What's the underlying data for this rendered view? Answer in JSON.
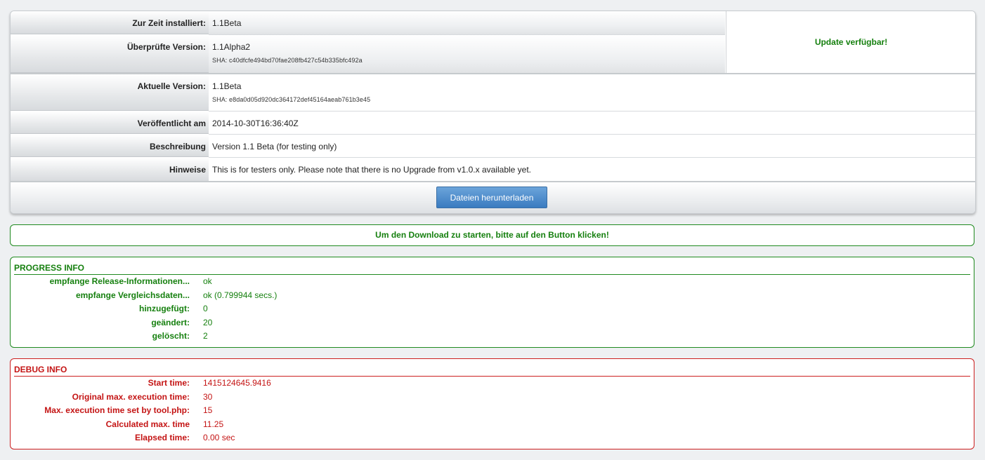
{
  "version_panel": {
    "installed_label": "Zur Zeit installiert:",
    "installed_value": "1.1Beta",
    "checked_label": "Überprüfte Version:",
    "checked_value": "1.1Alpha2",
    "checked_sha": "SHA: c40dfcfe494bd70fae208fb427c54b335bfc492a",
    "update_status": "Update verfügbar!",
    "current_label": "Aktuelle Version:",
    "current_value": "1.1Beta",
    "current_sha": "SHA: e8da0d05d920dc364172def45164aeab761b3e45",
    "published_label": "Veröffentlicht am",
    "published_value": "2014-10-30T16:36:40Z",
    "description_label": "Beschreibung",
    "description_value": "Version 1.1 Beta (for testing only)",
    "notes_label": "Hinweise",
    "notes_value": "This is for testers only. Please note that there is no Upgrade from v1.0.x available yet.",
    "download_button": "Dateien herunterladen"
  },
  "notice": "Um den Download zu starten, bitte auf den Button klicken!",
  "progress_info": {
    "title": "PROGRESS INFO",
    "rows": [
      {
        "key": "empfange Release-Informationen...",
        "value": "ok"
      },
      {
        "key": "empfange Vergleichsdaten...",
        "value": "ok (0.799944 secs.)"
      },
      {
        "key": "hinzugefügt:",
        "value": "0"
      },
      {
        "key": "geändert:",
        "value": "20"
      },
      {
        "key": "gelöscht:",
        "value": "2"
      }
    ]
  },
  "debug_info": {
    "title": "DEBUG INFO",
    "rows": [
      {
        "key": "Start time:",
        "value": "1415124645.9416"
      },
      {
        "key": "Original max. execution time:",
        "value": "30"
      },
      {
        "key": "Max. execution time set by tool.php:",
        "value": "15"
      },
      {
        "key": "Calculated max. time",
        "value": "11.25"
      },
      {
        "key": "Elapsed time:",
        "value": "0.00 sec"
      }
    ]
  },
  "colors": {
    "success": "#16800f",
    "error": "#c41414",
    "button": "#3a7bc0"
  }
}
